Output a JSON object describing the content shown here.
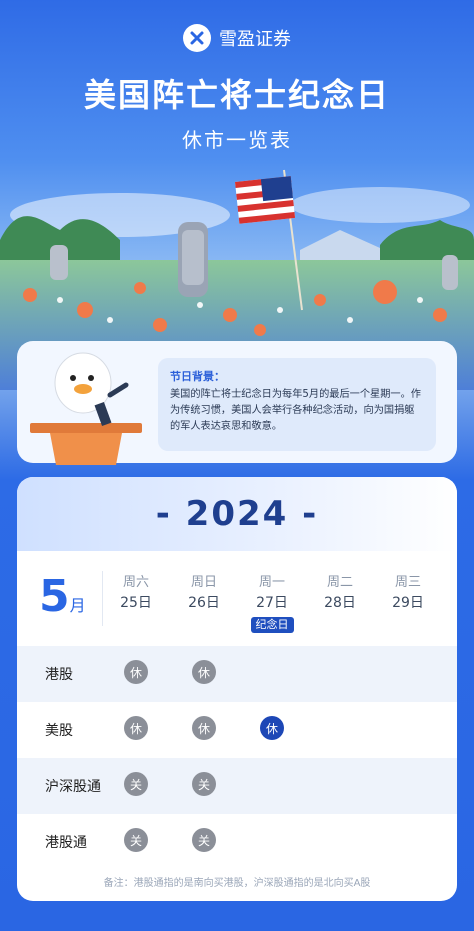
{
  "brand": {
    "name": "雪盈证券",
    "icon": "x-logo-icon"
  },
  "title": "美国阵亡将士纪念日",
  "subtitle": "休市一览表",
  "background": {
    "heading": "节日背景：",
    "text": "美国的阵亡将士纪念日为每年5月的最后一个星期一。作为传统习惯，美国人会举行各种纪念活动，向为国捐躯的军人表达哀思和敬意。"
  },
  "schedule": {
    "year": "- 2024 -",
    "month_num": "5",
    "month_unit": "月",
    "days": [
      {
        "weekday": "周六",
        "date": "25日",
        "tag": ""
      },
      {
        "weekday": "周日",
        "date": "26日",
        "tag": ""
      },
      {
        "weekday": "周一",
        "date": "27日",
        "tag": "纪念日"
      },
      {
        "weekday": "周二",
        "date": "28日",
        "tag": ""
      },
      {
        "weekday": "周三",
        "date": "29日",
        "tag": ""
      }
    ],
    "rows": [
      {
        "label": "港股",
        "cells": [
          "休",
          "休",
          "",
          "",
          ""
        ],
        "colors": [
          "gray",
          "gray",
          "",
          "",
          ""
        ]
      },
      {
        "label": "美股",
        "cells": [
          "休",
          "休",
          "休",
          "",
          ""
        ],
        "colors": [
          "gray",
          "gray",
          "blue",
          "",
          ""
        ]
      },
      {
        "label": "沪深股通",
        "cells": [
          "关",
          "关",
          "",
          "",
          ""
        ],
        "colors": [
          "gray",
          "gray",
          "",
          "",
          ""
        ]
      },
      {
        "label": "港股通",
        "cells": [
          "关",
          "关",
          "",
          "",
          ""
        ],
        "colors": [
          "gray",
          "gray",
          "",
          "",
          ""
        ]
      }
    ],
    "note": "备注：港股通指的是南向买港股，沪深股通指的是北向买A股"
  },
  "colors": {
    "primary": "#2a66e3",
    "closed_gray": "#8b8f98",
    "closed_blue": "#1d47b6"
  }
}
